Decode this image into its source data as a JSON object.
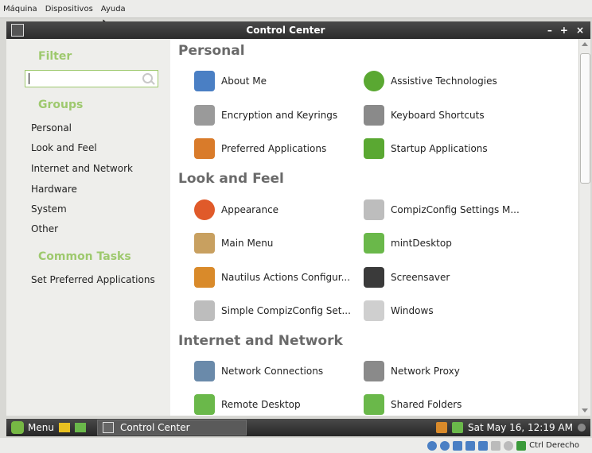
{
  "vbox_menu": {
    "machine": "Máquina",
    "devices": "Dispositivos",
    "help": "Ayuda"
  },
  "window": {
    "title": "Control Center",
    "minimize": "–",
    "maximize": "+",
    "close": "×"
  },
  "sidebar": {
    "filter_heading": "Filter",
    "search_placeholder": "",
    "groups_heading": "Groups",
    "groups": [
      "Personal",
      "Look and Feel",
      "Internet and Network",
      "Hardware",
      "System",
      "Other"
    ],
    "tasks_heading": "Common Tasks",
    "tasks": [
      "Set Preferred Applications"
    ]
  },
  "sections": [
    {
      "title": "Personal",
      "items": [
        {
          "label": "About Me",
          "icon": "about-me-icon",
          "color": "#4a7fc4"
        },
        {
          "label": "Assistive Technologies",
          "icon": "accessibility-icon",
          "color": "#5aa832"
        },
        {
          "label": "Encryption and Keyrings",
          "icon": "keyring-icon",
          "color": "#9a9a9a"
        },
        {
          "label": "Keyboard Shortcuts",
          "icon": "keyboard-icon",
          "color": "#8a8a8a"
        },
        {
          "label": "Preferred Applications",
          "icon": "preferred-apps-icon",
          "color": "#d97b2a"
        },
        {
          "label": "Startup Applications",
          "icon": "startup-icon",
          "color": "#5aa832"
        }
      ]
    },
    {
      "title": "Look and Feel",
      "items": [
        {
          "label": "Appearance",
          "icon": "appearance-icon",
          "color": "#e05a2a"
        },
        {
          "label": "CompizConfig Settings M...",
          "icon": "compiz-icon",
          "color": "#bdbdbd"
        },
        {
          "label": "Main Menu",
          "icon": "main-menu-icon",
          "color": "#c8a060"
        },
        {
          "label": "mintDesktop",
          "icon": "mintdesktop-icon",
          "color": "#6ab84a"
        },
        {
          "label": "Nautilus Actions Configur...",
          "icon": "nautilus-actions-icon",
          "color": "#d98a2a"
        },
        {
          "label": "Screensaver",
          "icon": "screensaver-icon",
          "color": "#3a3a3a"
        },
        {
          "label": "Simple CompizConfig Set...",
          "icon": "simple-compiz-icon",
          "color": "#bdbdbd"
        },
        {
          "label": "Windows",
          "icon": "windows-icon",
          "color": "#cfcfcf"
        }
      ]
    },
    {
      "title": "Internet and Network",
      "items": [
        {
          "label": "Network Connections",
          "icon": "network-icon",
          "color": "#6a8aaa"
        },
        {
          "label": "Network Proxy",
          "icon": "proxy-icon",
          "color": "#8a8a8a"
        },
        {
          "label": "Remote Desktop",
          "icon": "remote-desktop-icon",
          "color": "#6ab84a"
        },
        {
          "label": "Shared Folders",
          "icon": "shared-folders-icon",
          "color": "#6ab84a"
        }
      ]
    }
  ],
  "panel": {
    "menu_label": "Menu",
    "task_label": "Control Center",
    "clock": "Sat May 16, 12:19 AM"
  },
  "statusbar": {
    "host_key": "Ctrl Derecho"
  }
}
